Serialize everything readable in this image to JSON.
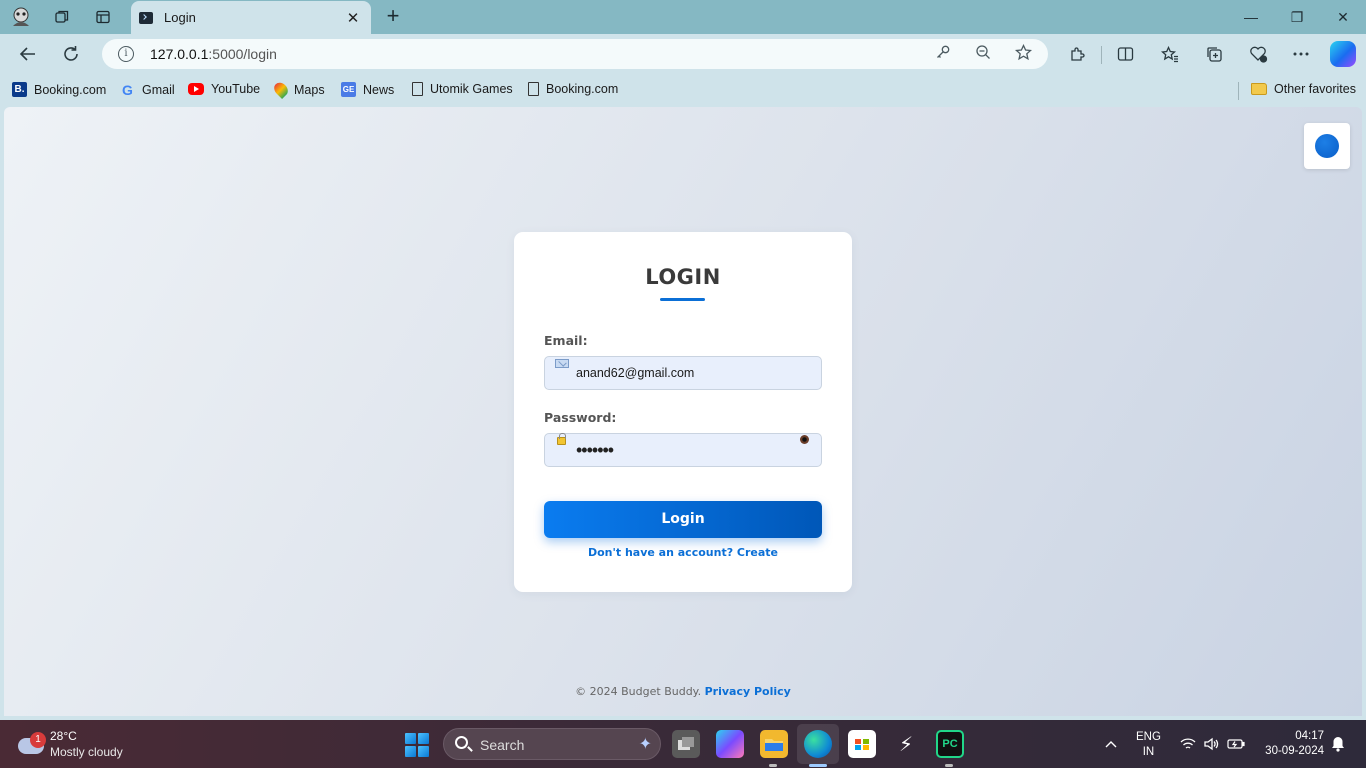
{
  "browser": {
    "tab_title": "Login",
    "tab_close": "✕",
    "new_tab": "+",
    "window_controls": {
      "minimize": "—",
      "restore": "❐",
      "close": "✕"
    },
    "url_host": "127.0.0.1",
    "url_path": ":5000/login",
    "favorites": [
      {
        "label": "Booking.com",
        "icon": "booking-icon"
      },
      {
        "label": "Gmail",
        "icon": "google-icon"
      },
      {
        "label": "YouTube",
        "icon": "youtube-icon"
      },
      {
        "label": "Maps",
        "icon": "maps-icon"
      },
      {
        "label": "News",
        "icon": "news-icon"
      },
      {
        "label": "Utomik Games",
        "icon": "page-icon"
      },
      {
        "label": "Booking.com",
        "icon": "page-icon"
      }
    ],
    "other_favorites": "Other favorites"
  },
  "page": {
    "heading": "LOGIN",
    "email_label": "Email:",
    "email_value": "anand62@gmail.com",
    "password_label": "Password:",
    "password_value": "•••••••",
    "login_button": "Login",
    "signup_link": "Don't have an account? Create",
    "footer_text": "© 2024 Budget Buddy.",
    "footer_link": "Privacy Policy",
    "accent_color": "#0b6fd6"
  },
  "taskbar": {
    "weather_badge": "1",
    "temperature": "28°C",
    "weather_desc": "Mostly cloudy",
    "search_label": "Search",
    "lang_1": "ENG",
    "lang_2": "IN",
    "time": "04:17",
    "date": "30-09-2024"
  }
}
